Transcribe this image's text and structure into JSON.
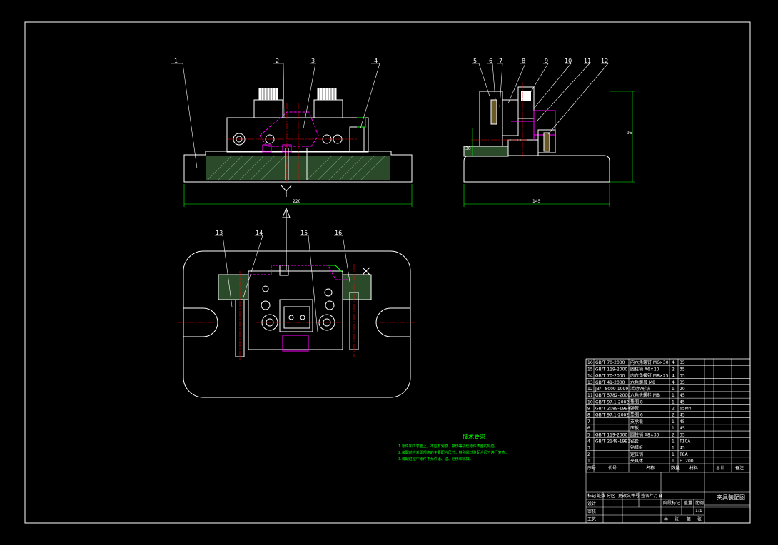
{
  "drawing": {
    "front_view_labels": [
      "1",
      "2",
      "3",
      "4"
    ],
    "side_view_labels": [
      "5",
      "6",
      "7",
      "8",
      "9",
      "10",
      "11",
      "12"
    ],
    "top_view_labels": [
      "13",
      "14",
      "15",
      "16"
    ],
    "view_marker": "Y",
    "dimensions": {
      "front_width": "220",
      "side_width": "145",
      "side_height": "95",
      "side_small": "30"
    }
  },
  "technical_requirements": {
    "title": "技术要求",
    "lines": [
      "1.零件加工表面上，不应有划痕、擦伤等损伤零件表面的缺陷。",
      "2.装配前应对零部件的主要配合尺寸，特别是过盈配合尺寸进行复查。",
      "3.装配过程中零件不允许磕、碰、划伤和锈蚀。"
    ]
  },
  "title_block": {
    "header": {
      "seq": "序号",
      "code": "代号",
      "name": "名称",
      "qty": "数量",
      "material": "材料",
      "total": "总计",
      "note": "备注"
    },
    "drawing_name": "夹具装配图",
    "scale": "1:1",
    "rows": [
      {
        "seq": "16",
        "code": "GB/T 70-2000",
        "name": "内六角螺钉 M6×30",
        "qty": "4",
        "material": "35"
      },
      {
        "seq": "15",
        "code": "GB/T 119-2000",
        "name": "圆柱销 A6×20",
        "qty": "2",
        "material": "35"
      },
      {
        "seq": "14",
        "code": "GB/T 70-2000",
        "name": "内六角螺钉 M8×25",
        "qty": "4",
        "material": "35"
      },
      {
        "seq": "13",
        "code": "GB/T 41-2000",
        "name": "六角螺母 M8",
        "qty": "4",
        "material": "35"
      },
      {
        "seq": "12",
        "code": "JB/T 8009-1999",
        "name": "活动V形块",
        "qty": "1",
        "material": "20"
      },
      {
        "seq": "11",
        "code": "GB/T 5782-2000",
        "name": "六角头螺栓 M8",
        "qty": "1",
        "material": "45"
      },
      {
        "seq": "10",
        "code": "GB/T 97.1-2002",
        "name": "垫圈 8",
        "qty": "1",
        "material": "45"
      },
      {
        "seq": "9",
        "code": "GB/T 2089-1994",
        "name": "弹簧",
        "qty": "2",
        "material": "65Mn"
      },
      {
        "seq": "8",
        "code": "GB/T 97.1-2002",
        "name": "垫圈 6",
        "qty": "2",
        "material": "45"
      },
      {
        "seq": "7",
        "code": "",
        "name": "支承板",
        "qty": "1",
        "material": "45"
      },
      {
        "seq": "6",
        "code": "",
        "name": "压板",
        "qty": "1",
        "material": "45"
      },
      {
        "seq": "5",
        "code": "GB/T 119-2000",
        "name": "圆柱销 A8×30",
        "qty": "2",
        "material": "35"
      },
      {
        "seq": "4",
        "code": "GB/T 2148-1991",
        "name": "钻套",
        "qty": "1",
        "material": "T10A"
      },
      {
        "seq": "3",
        "code": "",
        "name": "钻模板",
        "qty": "1",
        "material": "45"
      },
      {
        "seq": "2",
        "code": "",
        "name": "定位销",
        "qty": "1",
        "material": "T8A"
      },
      {
        "seq": "1",
        "code": "",
        "name": "夹具体",
        "qty": "1",
        "material": "HT200"
      }
    ],
    "sign_cells": [
      "标记",
      "处数",
      "分区",
      "更改文件号",
      "签名",
      "年月日"
    ],
    "role_cells": [
      "设计",
      "审核",
      "工艺"
    ],
    "stage_cells": [
      "阶段标记",
      "重量",
      "比例"
    ],
    "sheet_cells": [
      "共",
      "张",
      "第",
      "张"
    ]
  }
}
